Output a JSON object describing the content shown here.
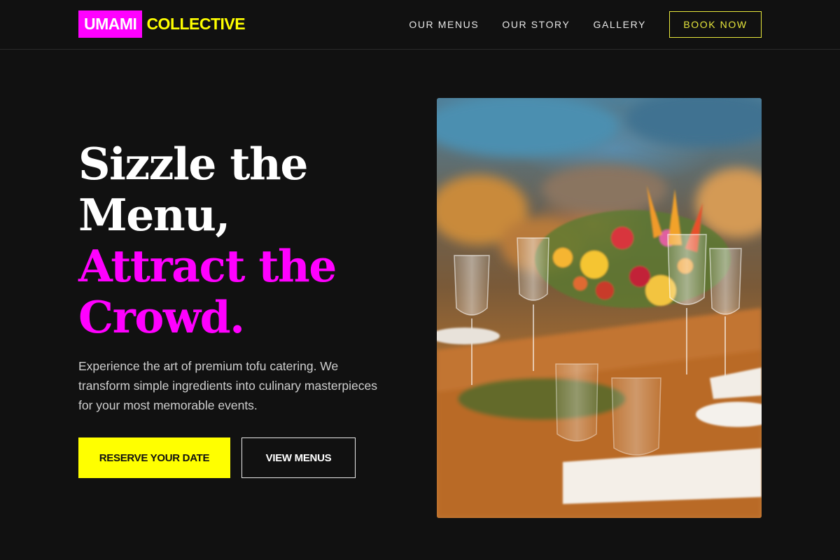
{
  "brand": {
    "part1": "UMAMI",
    "part2": "COLLECTIVE",
    "colors": {
      "magenta": "#ff00ff",
      "yellow": "#ffff00",
      "background": "#111111"
    }
  },
  "nav": {
    "links": [
      "OUR MENUS",
      "OUR STORY",
      "GALLERY"
    ],
    "cta": "BOOK NOW"
  },
  "hero": {
    "headline_line1": "Sizzle the Menu,",
    "headline_line2": "Attract the Crowd.",
    "subtext": "Experience the art of premium tofu catering. We transform simple ingredients into culinary masterpieces for your most memorable events.",
    "primary_cta": "RESERVE YOUR DATE",
    "secondary_cta": "VIEW MENUS"
  }
}
